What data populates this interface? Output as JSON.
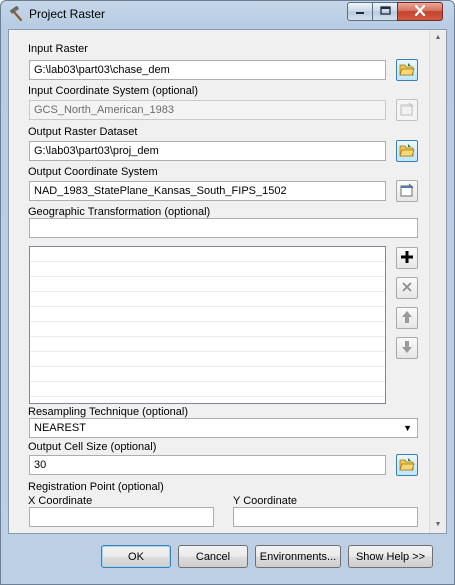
{
  "window": {
    "title": "Project Raster",
    "title_icon": "hammer-tool-icon"
  },
  "form": {
    "input_raster": {
      "label": "Input Raster",
      "value": "G:\\lab03\\part03\\chase_dem"
    },
    "input_cs": {
      "label": "Input Coordinate System (optional)",
      "value": "GCS_North_American_1983"
    },
    "output_raster": {
      "label": "Output Raster Dataset",
      "value": "G:\\lab03\\part03\\proj_dem"
    },
    "output_cs": {
      "label": "Output Coordinate System",
      "value": "NAD_1983_StatePlane_Kansas_South_FIPS_1502"
    },
    "geo_transform": {
      "label": "Geographic Transformation (optional)",
      "value": ""
    },
    "resampling": {
      "label": "Resampling Technique (optional)",
      "value": "NEAREST"
    },
    "cell_size": {
      "label": "Output Cell Size (optional)",
      "value": "30"
    },
    "registration": {
      "label": "Registration Point (optional)",
      "x_label": "X Coordinate",
      "y_label": "Y Coordinate",
      "x_value": "",
      "y_value": ""
    }
  },
  "buttons": {
    "ok": "OK",
    "cancel": "Cancel",
    "environments": "Environments...",
    "show_help": "Show Help >>"
  },
  "colors": {
    "title_bar": "#bccfe4",
    "close_button": "#c1432e",
    "client_bg": "#f0f0f0"
  }
}
